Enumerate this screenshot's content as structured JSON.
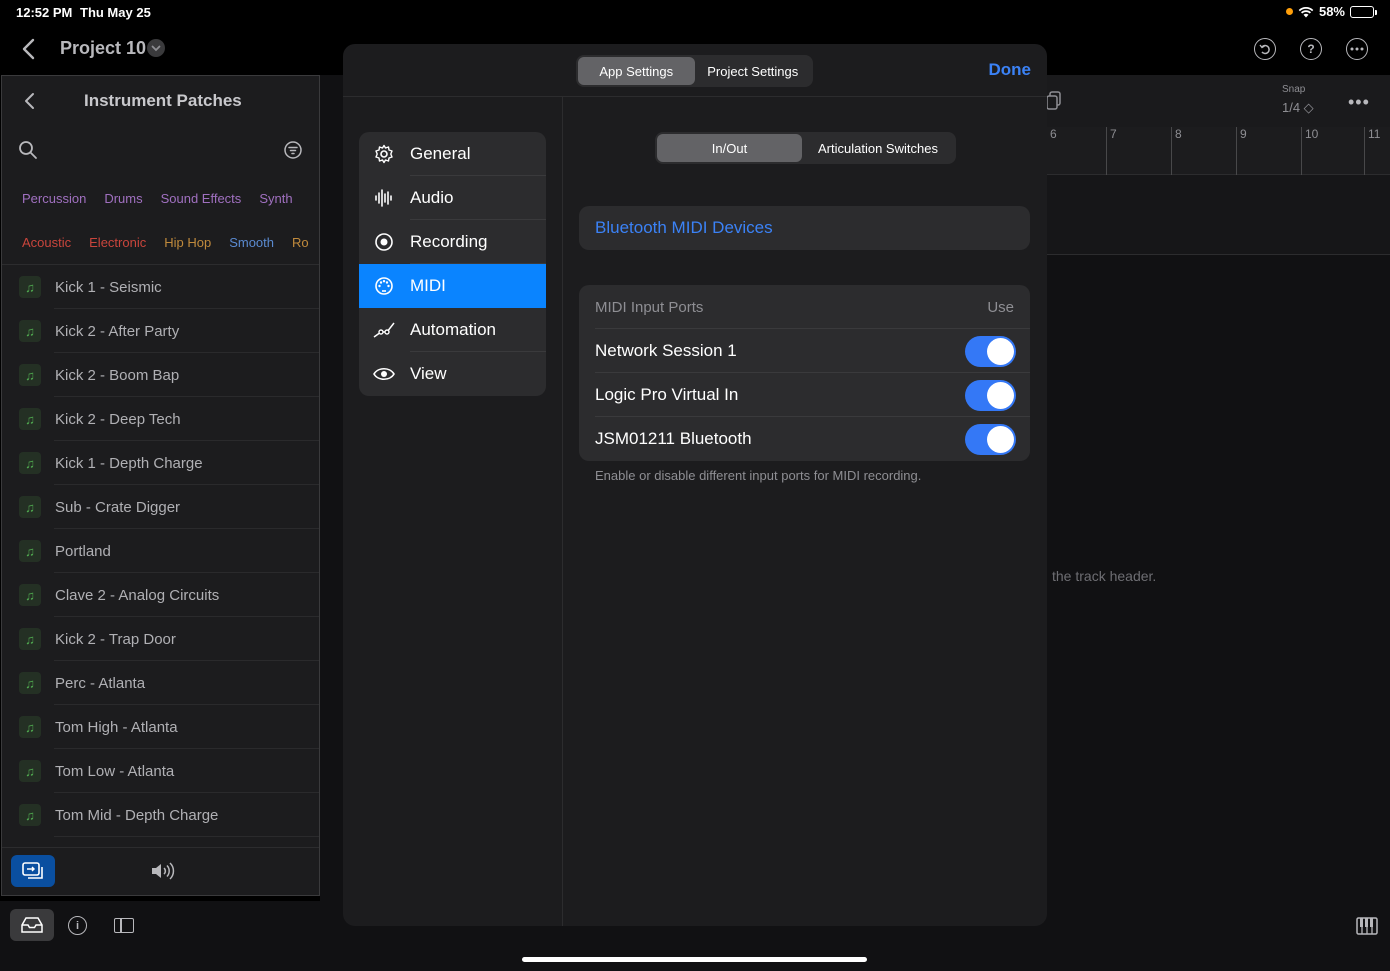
{
  "status": {
    "time": "12:52 PM",
    "date": "Thu May 25",
    "battery": "58%",
    "battery_level": 0.58
  },
  "topbar": {
    "project_title": "Project 10"
  },
  "library": {
    "title": "Instrument Patches",
    "tags_row1": [
      "Percussion",
      "Drums",
      "Sound Effects",
      "Synth"
    ],
    "tags_row2": [
      "Acoustic",
      "Electronic",
      "Hip Hop",
      "Smooth",
      "Ro"
    ],
    "patches": [
      "Kick 1 - Seismic",
      "Kick 2 - After Party",
      "Kick 2 - Boom Bap",
      "Kick 2 - Deep Tech",
      "Kick 1 - Depth Charge",
      "Sub - Crate Digger",
      "Portland",
      "Clave 2 - Analog Circuits",
      "Kick 2 - Trap Door",
      "Perc - Atlanta",
      "Tom High - Atlanta",
      "Tom Low - Atlanta",
      "Tom Mid - Depth Charge"
    ]
  },
  "track_area": {
    "snap_label": "Snap",
    "snap_value": "1/4 ◇",
    "ruler_marks": [
      "6",
      "7",
      "8",
      "9",
      "10",
      "11"
    ],
    "hint": "the track header."
  },
  "modal": {
    "top_tabs": [
      "App Settings",
      "Project Settings"
    ],
    "active_top_tab": "App Settings",
    "done_label": "Done",
    "menu": [
      {
        "label": "General",
        "icon": "gear-icon"
      },
      {
        "label": "Audio",
        "icon": "waveform-icon"
      },
      {
        "label": "Recording",
        "icon": "record-icon"
      },
      {
        "label": "MIDI",
        "icon": "midi-port-icon"
      },
      {
        "label": "Automation",
        "icon": "automation-curve-icon"
      },
      {
        "label": "View",
        "icon": "eye-icon"
      }
    ],
    "active_menu": "MIDI",
    "sub_tabs": [
      "In/Out",
      "Articulation Switches"
    ],
    "active_sub_tab": "In/Out",
    "bluetooth_label": "Bluetooth MIDI Devices",
    "ports_header": "MIDI Input Ports",
    "ports_use_label": "Use",
    "ports": [
      {
        "name": "Network Session 1",
        "enabled": true
      },
      {
        "name": "Logic Pro Virtual In",
        "enabled": true
      },
      {
        "name": "JSM01211 Bluetooth",
        "enabled": true
      }
    ],
    "ports_footer": "Enable or disable different input ports for MIDI recording."
  },
  "colors": {
    "accent": "#0a84ff",
    "link": "#3b82f6",
    "toggle_on": "#3478f6"
  }
}
